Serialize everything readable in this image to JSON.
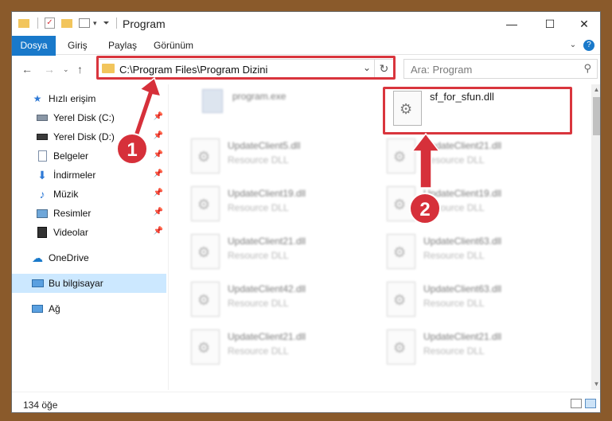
{
  "window": {
    "title": "Program",
    "controls": {
      "minimize": "—",
      "maximize": "☐",
      "close": "✕"
    }
  },
  "ribbon": {
    "tabs": [
      "Dosya",
      "Giriş",
      "Paylaş",
      "Görünüm"
    ],
    "help_icon": "?"
  },
  "address": {
    "path": "C:\\Program Files\\Program Dizini",
    "search_placeholder": "Ara: Program"
  },
  "sidebar": {
    "quick_access": "Hızlı erişim",
    "items": [
      {
        "label": "Yerel Disk (C:)",
        "icon": "drive-icon",
        "pinned": true
      },
      {
        "label": "Yerel Disk (D:)",
        "icon": "drive-icon",
        "pinned": true
      },
      {
        "label": "Belgeler",
        "icon": "documents-icon",
        "pinned": true
      },
      {
        "label": "İndirmeler",
        "icon": "download-icon",
        "pinned": true
      },
      {
        "label": "Müzik",
        "icon": "music-icon",
        "pinned": true
      },
      {
        "label": "Resimler",
        "icon": "pictures-icon",
        "pinned": true
      },
      {
        "label": "Videolar",
        "icon": "videos-icon",
        "pinned": true
      }
    ],
    "onedrive": "OneDrive",
    "this_pc": "Bu bilgisayar",
    "network": "Ağ"
  },
  "files": {
    "highlighted": {
      "name": "sf_for_sfun.dll"
    },
    "exe": {
      "name": "program.exe"
    },
    "grid": [
      {
        "name": "UpdateClient5.dll",
        "type": "Resource DLL"
      },
      {
        "name": "UpdateClient21.dll",
        "type": "Resource DLL"
      },
      {
        "name": "UpdateClient19.dll",
        "type": "Resource DLL"
      },
      {
        "name": "UpdateClient19.dll",
        "type": "Resource DLL"
      },
      {
        "name": "UpdateClient21.dll",
        "type": "Resource DLL"
      },
      {
        "name": "UpdateClient63.dll",
        "type": "Resource DLL"
      },
      {
        "name": "UpdateClient42.dll",
        "type": "Resource DLL"
      },
      {
        "name": "UpdateClient63.dll",
        "type": "Resource DLL"
      },
      {
        "name": "UpdateClient21.dll",
        "type": "Resource DLL"
      },
      {
        "name": "UpdateClient21.dll",
        "type": "Resource DLL"
      }
    ]
  },
  "status": {
    "count": "134 öğe"
  },
  "annotations": {
    "marker1": "1",
    "marker2": "2",
    "color": "#d6303a"
  }
}
